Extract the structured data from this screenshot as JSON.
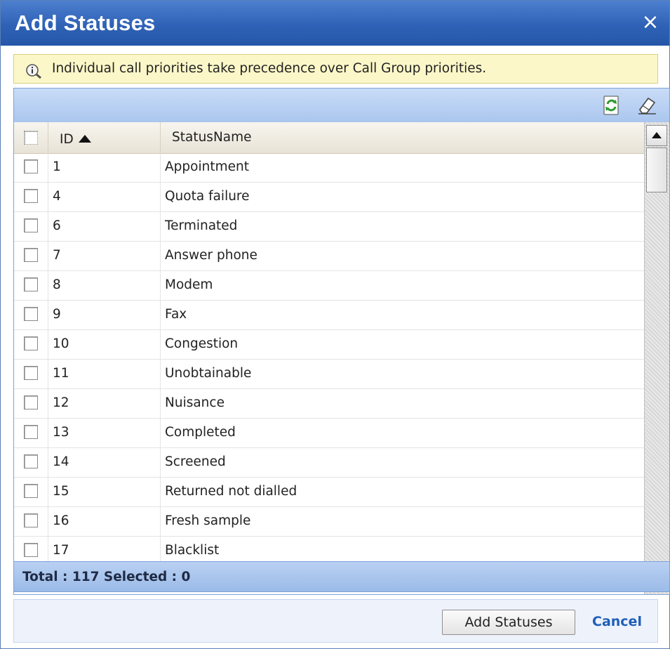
{
  "dialog": {
    "title": "Add Statuses",
    "close_icon": "×"
  },
  "notice": {
    "icon": "info-magnifier-icon",
    "text": "Individual call priorities take precedence over Call Group priorities."
  },
  "toolbar": {
    "refresh_icon": "refresh-icon",
    "clear_icon": "eraser-icon"
  },
  "grid": {
    "columns": {
      "id": "ID",
      "name": "StatusName"
    },
    "sort": {
      "column": "ID",
      "direction": "ascending"
    },
    "rows": [
      {
        "id": "1",
        "name": "Appointment",
        "checked": false
      },
      {
        "id": "4",
        "name": "Quota failure",
        "checked": false
      },
      {
        "id": "6",
        "name": "Terminated",
        "checked": false
      },
      {
        "id": "7",
        "name": "Answer phone",
        "checked": false
      },
      {
        "id": "8",
        "name": "Modem",
        "checked": false
      },
      {
        "id": "9",
        "name": "Fax",
        "checked": false
      },
      {
        "id": "10",
        "name": "Congestion",
        "checked": false
      },
      {
        "id": "11",
        "name": "Unobtainable",
        "checked": false
      },
      {
        "id": "12",
        "name": "Nuisance",
        "checked": false
      },
      {
        "id": "13",
        "name": "Completed",
        "checked": false
      },
      {
        "id": "14",
        "name": "Screened",
        "checked": false
      },
      {
        "id": "15",
        "name": "Returned not dialled",
        "checked": false
      },
      {
        "id": "16",
        "name": "Fresh sample",
        "checked": false
      },
      {
        "id": "17",
        "name": "Blacklist",
        "checked": false
      }
    ],
    "footer": "Total : 117 Selected : 0"
  },
  "actions": {
    "add_label": "Add Statuses",
    "cancel_label": "Cancel"
  },
  "colors": {
    "title_bar": "#2f62b6",
    "notice_bg": "#fbf7c8",
    "grid_bar": "#aac6ee",
    "link": "#1f5fb8"
  }
}
